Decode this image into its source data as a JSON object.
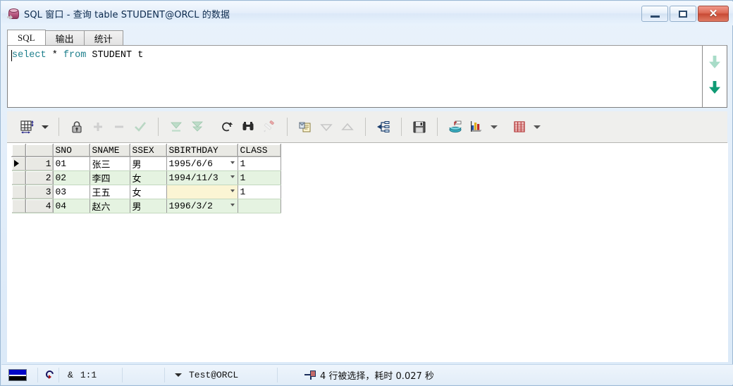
{
  "window": {
    "title": "SQL 窗口 - 查询 table STUDENT@ORCL 的数据",
    "icon": "database-icon",
    "minimize_label": "",
    "maximize_label": "",
    "close_label": "✕"
  },
  "tabs": [
    {
      "label": "SQL",
      "active": true
    },
    {
      "label": "输出",
      "active": false
    },
    {
      "label": "统计",
      "active": false
    }
  ],
  "editor": {
    "sql_keyword_1": "select",
    "sql_middle": " * ",
    "sql_keyword_2": "from",
    "sql_tail": " STUDENT t",
    "scroll_up_icon": "arrow-up-icon",
    "scroll_down_icon": "arrow-down-icon"
  },
  "toolbar": {
    "items": [
      {
        "name": "grid-layout-icon",
        "enabled": true,
        "dropdown": true
      },
      {
        "name": "lock-record-icon",
        "enabled": true
      },
      {
        "name": "insert-row-icon",
        "enabled": false
      },
      {
        "name": "delete-row-icon",
        "enabled": false
      },
      {
        "name": "post-changes-icon",
        "enabled": false
      },
      {
        "name": "fetch-next-page-icon",
        "enabled": false
      },
      {
        "name": "fetch-last-page-icon",
        "enabled": false
      },
      {
        "name": "refresh-icon",
        "enabled": true
      },
      {
        "name": "find-binoculars-icon",
        "enabled": true
      },
      {
        "name": "clear-filter-icon",
        "enabled": false
      },
      {
        "name": "copy-to-clipboard-icon",
        "enabled": true
      },
      {
        "name": "sort-descending-icon",
        "enabled": false
      },
      {
        "name": "sort-ascending-icon",
        "enabled": false
      },
      {
        "name": "query-builder-icon",
        "enabled": true
      },
      {
        "name": "save-icon",
        "enabled": true
      },
      {
        "name": "export-data-icon",
        "enabled": true
      },
      {
        "name": "chart-icon",
        "enabled": true,
        "dropdown": true
      },
      {
        "name": "report-grid-icon",
        "enabled": true,
        "dropdown": true
      }
    ]
  },
  "grid": {
    "columns": [
      "SNO",
      "SNAME",
      "SSEX",
      "SBIRTHDAY",
      "CLASS"
    ],
    "rows": [
      {
        "num": "1",
        "current": true,
        "green": false,
        "cells": {
          "SNO": "01",
          "SNAME": "张三",
          "SSEX": "男",
          "SBIRTHDAY": "1995/6/6",
          "CLASS": "1"
        }
      },
      {
        "num": "2",
        "current": false,
        "green": true,
        "cells": {
          "SNO": "02",
          "SNAME": "李四",
          "SSEX": "女",
          "SBIRTHDAY": "1994/11/3",
          "CLASS": "1"
        }
      },
      {
        "num": "3",
        "current": false,
        "green": false,
        "birthday_highlight": true,
        "cells": {
          "SNO": "03",
          "SNAME": "王五",
          "SSEX": "女",
          "SBIRTHDAY": "",
          "CLASS": "1"
        }
      },
      {
        "num": "4",
        "current": false,
        "green": true,
        "cells": {
          "SNO": "04",
          "SNAME": "赵六",
          "SSEX": "男",
          "SBIRTHDAY": "1996/3/2",
          "CLASS": ""
        }
      }
    ]
  },
  "statusbar": {
    "mode_icon": "insert-mode-icon",
    "refresh_icon": "refresh-session-icon",
    "modified_marker": "&",
    "cursor_position": "1:1",
    "session_dropdown_icon": "chevron-down-icon",
    "connection": "Test@ORCL",
    "result_icon": "rows-fetched-icon",
    "result_text": "4 行被选择，耗时 0.027 秒"
  },
  "colors": {
    "keyword": "#1d7f8c",
    "row_green": "#e5f3e1",
    "cell_highlight": "#fbf5d4",
    "titlebar": "#e4eefa",
    "close_button": "#c84a34"
  }
}
